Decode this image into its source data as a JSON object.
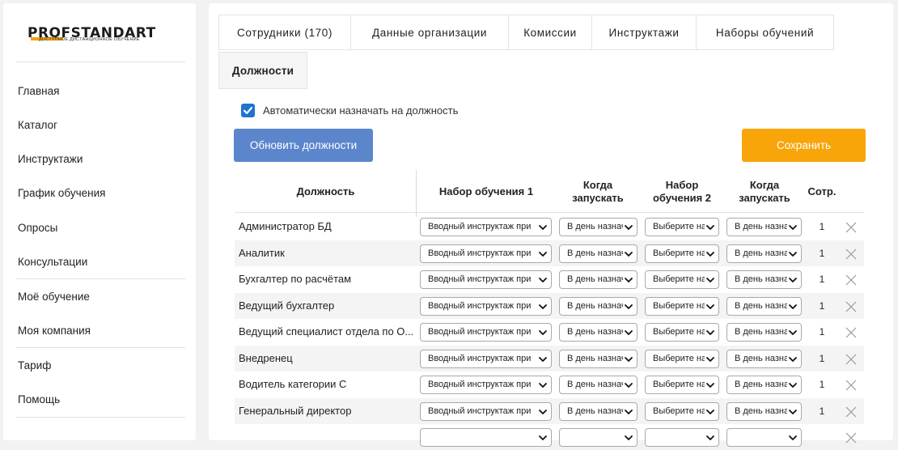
{
  "logo": {
    "text": "PROFSTANDART",
    "subtitle": "ДОСТУПНОЕ ДИСТАНЦИОННОЕ ОБУЧЕНИЕ"
  },
  "sidebar": {
    "items": [
      {
        "label": "Главная"
      },
      {
        "label": "Каталог"
      },
      {
        "label": "Инструктажи"
      },
      {
        "label": "График обучения"
      },
      {
        "label": "Опросы"
      },
      {
        "label": "Консультации"
      },
      {
        "label": "Моё обучение"
      },
      {
        "label": "Моя компания"
      },
      {
        "label": "Тариф"
      },
      {
        "label": "Помощь"
      }
    ]
  },
  "tabs": [
    {
      "label": "Сотрудники (170)"
    },
    {
      "label": "Данные организации"
    },
    {
      "label": "Комиссии"
    },
    {
      "label": "Инструктажи"
    },
    {
      "label": "Наборы обучений"
    },
    {
      "label": "Должности",
      "active": true
    }
  ],
  "auto_assign": {
    "label": "Автоматически назначать на должность",
    "checked": true
  },
  "buttons": {
    "update": "Обновить должности",
    "save": "Сохранить"
  },
  "colors": {
    "primary": "#5b86cc",
    "accent": "#f8a50a",
    "checkbox": "#1f73d3"
  },
  "table": {
    "headers": {
      "position": "Должность",
      "set1": "Набор обучения 1",
      "when1_line1": "Когда",
      "when1_line2": "запускать",
      "set2_line1": "Набор",
      "set2_line2": "обучения 2",
      "when2_line1": "Когда",
      "when2_line2": "запускать",
      "count": "Сотр."
    },
    "rows": [
      {
        "name": "Администратор БД",
        "set1": "Вводный инструктаж при",
        "when1": "В день назначения",
        "set2": "Выберите набор",
        "when2": "В день назначения",
        "count": "1"
      },
      {
        "name": "Аналитик",
        "set1": "Вводный инструктаж при",
        "when1": "В день назначения",
        "set2": "Выберите набор",
        "when2": "В день назначения",
        "count": "1"
      },
      {
        "name": "Бухгалтер по расчётам",
        "set1": "Вводный инструктаж при",
        "when1": "В день назначения",
        "set2": "Выберите набор",
        "when2": "В день назначения",
        "count": "1"
      },
      {
        "name": "Ведущий бухгалтер",
        "set1": "Вводный инструктаж при",
        "when1": "В день назначения",
        "set2": "Выберите набор",
        "when2": "В день назначения",
        "count": "1"
      },
      {
        "name": "Ведущий специалист отдела по О...",
        "set1": "Вводный инструктаж при",
        "when1": "В день назначения",
        "set2": "Выберите набор",
        "when2": "В день назначения",
        "count": "1"
      },
      {
        "name": "Внедренец",
        "set1": "Вводный инструктаж при",
        "when1": "В день назначения",
        "set2": "Выберите набор",
        "when2": "В день назначения",
        "count": "1"
      },
      {
        "name": "Водитель категории С",
        "set1": "Вводный инструктаж при",
        "when1": "В день назначения",
        "set2": "Выберите набор",
        "when2": "В день назначения",
        "count": "1"
      },
      {
        "name": "Генеральный директор",
        "set1": "Вводный инструктаж при",
        "when1": "В день назначения",
        "set2": "Выберите набор",
        "when2": "В день назначения",
        "count": "1"
      },
      {
        "name": "",
        "set1": "",
        "when1": "",
        "set2": "",
        "when2": "",
        "count": ""
      }
    ]
  }
}
